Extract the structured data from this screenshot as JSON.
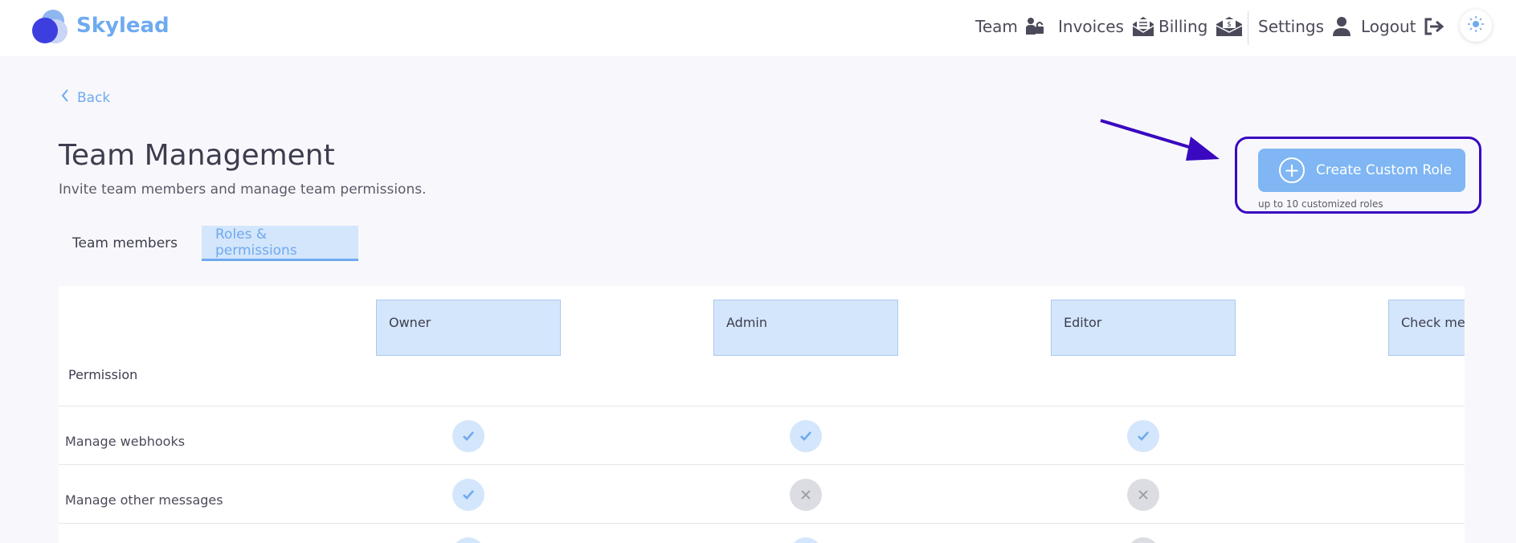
{
  "brand": {
    "name": "Skylead"
  },
  "nav": {
    "team": "Team",
    "invoices": "Invoices",
    "billing": "Billing",
    "settings": "Settings",
    "logout": "Logout"
  },
  "page": {
    "back_label": "Back",
    "title": "Team Management",
    "subtitle": "Invite team members and manage team permissions."
  },
  "actions": {
    "create_custom_role": "Create Custom Role",
    "create_note": "up to 10 customized roles"
  },
  "tabs": [
    {
      "label": "Team members",
      "active": false
    },
    {
      "label": "Roles & permissions",
      "active": true
    }
  ],
  "table": {
    "permission_header": "Permission",
    "roles": [
      "Owner",
      "Admin",
      "Editor",
      "Check mes"
    ],
    "rows": [
      {
        "label": "Manage webhooks",
        "values": [
          true,
          true,
          true
        ]
      },
      {
        "label": "Manage other messages",
        "values": [
          true,
          false,
          false
        ]
      },
      {
        "label": "",
        "values": [
          true,
          true,
          false
        ]
      }
    ]
  },
  "colors": {
    "accent": "#6eaaf0",
    "highlight": "#3a08c0",
    "yes": "#d4e6fb",
    "no": "#dcdde2"
  },
  "icons": {
    "team": "team-lock-icon",
    "invoices": "invoice-envelope-icon",
    "billing": "billing-envelope-icon",
    "settings": "user-icon",
    "logout": "logout-icon",
    "theme": "sun-icon"
  }
}
